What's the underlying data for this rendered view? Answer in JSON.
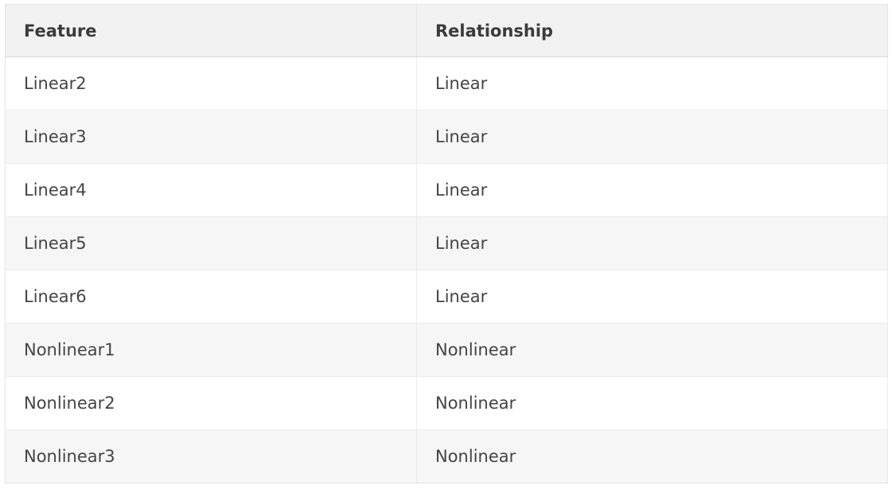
{
  "table": {
    "headers": [
      "Feature",
      "Relationship"
    ],
    "rows": [
      [
        "Linear2",
        "Linear"
      ],
      [
        "Linear3",
        "Linear"
      ],
      [
        "Linear4",
        "Linear"
      ],
      [
        "Linear5",
        "Linear"
      ],
      [
        "Linear6",
        "Linear"
      ],
      [
        "Nonlinear1",
        "Nonlinear"
      ],
      [
        "Nonlinear2",
        "Nonlinear"
      ],
      [
        "Nonlinear3",
        "Nonlinear"
      ]
    ]
  }
}
